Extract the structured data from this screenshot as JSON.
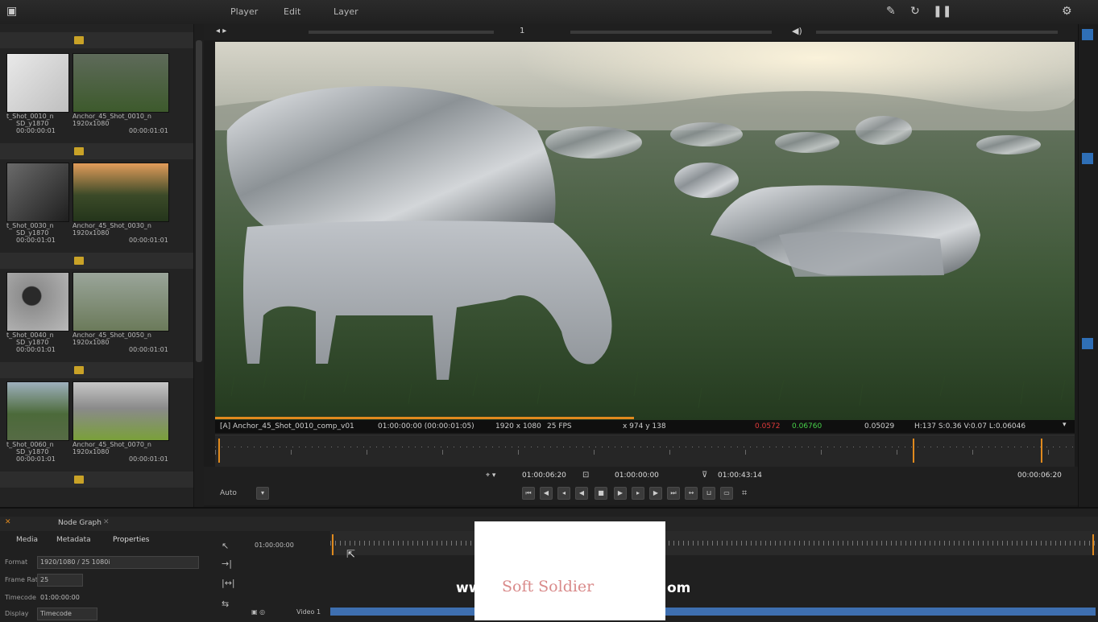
{
  "menu": {
    "items": [
      "Player",
      "Edit",
      "Layer"
    ]
  },
  "viewer": {
    "frame_counter": "1",
    "info": {
      "clip": "[A] Anchor_45_Shot_0010_comp_v01",
      "timecode": "01:00:00:00 (00:00:01:05)",
      "resolution": "1920 x 1080",
      "fps": "25 FPS",
      "coords": "x 974 y 138",
      "value_r": "0.0572",
      "value_g": "0.06760",
      "value_b": "0.05029",
      "hsv": "H:137 S:0.36 V:0.07 L:0.06046"
    }
  },
  "transport": {
    "timecode_in": "01:00:06:20",
    "timecode_current": "01:00:00:00",
    "timecode_out": "01:00:43:14",
    "duration": "00:00:06:20",
    "audio_label": "Auto"
  },
  "bin": {
    "clips": [
      {
        "name": "t_Shot_0010_n",
        "meta": "SD_y1870",
        "tc": "00:00:00:01"
      },
      {
        "name": "Anchor_45_Shot_0010_n",
        "meta": "1920x1080",
        "tc": "00:00:01:01"
      },
      {
        "name": "t_Shot_0030_n",
        "meta": "SD_y1870",
        "tc": "00:00:01:01"
      },
      {
        "name": "Anchor_45_Shot_0030_n",
        "meta": "1920x1080",
        "tc": "00:00:01:01"
      },
      {
        "name": "t_Shot_0040_n",
        "meta": "SD_y1870",
        "tc": "00:00:01:01"
      },
      {
        "name": "Anchor_45_Shot_0050_n",
        "meta": "1920x1080",
        "tc": "00:00:01:01"
      },
      {
        "name": "t_Shot_0060_n",
        "meta": "SD_y1870",
        "tc": "00:00:01:01"
      },
      {
        "name": "Anchor_45_Shot_0070_n",
        "meta": "1920x1080",
        "tc": "00:00:01:01"
      }
    ]
  },
  "bottom": {
    "tabs": [
      "Node Graph"
    ],
    "subtabs": [
      "Media",
      "Metadata",
      "Properties"
    ],
    "fields": [
      {
        "label": "Format",
        "value": "1920/1080 / 25 1080i"
      },
      {
        "label": "Frame Rate",
        "value": "25"
      },
      {
        "label": "Timecode",
        "value": "01:00:00:00"
      },
      {
        "label": "Display",
        "value": "Timecode"
      }
    ],
    "seq_start": "01:00:00:00",
    "track_label": "Video 1"
  },
  "watermark": {
    "text_left": "ww",
    "text_right": "om",
    "brand": "Soft Soldier"
  },
  "colors": {
    "accent": "#e08a1e",
    "track_blue": "#3e6fb0",
    "red_value": "#e03b3b",
    "green_value": "#48d24a"
  }
}
